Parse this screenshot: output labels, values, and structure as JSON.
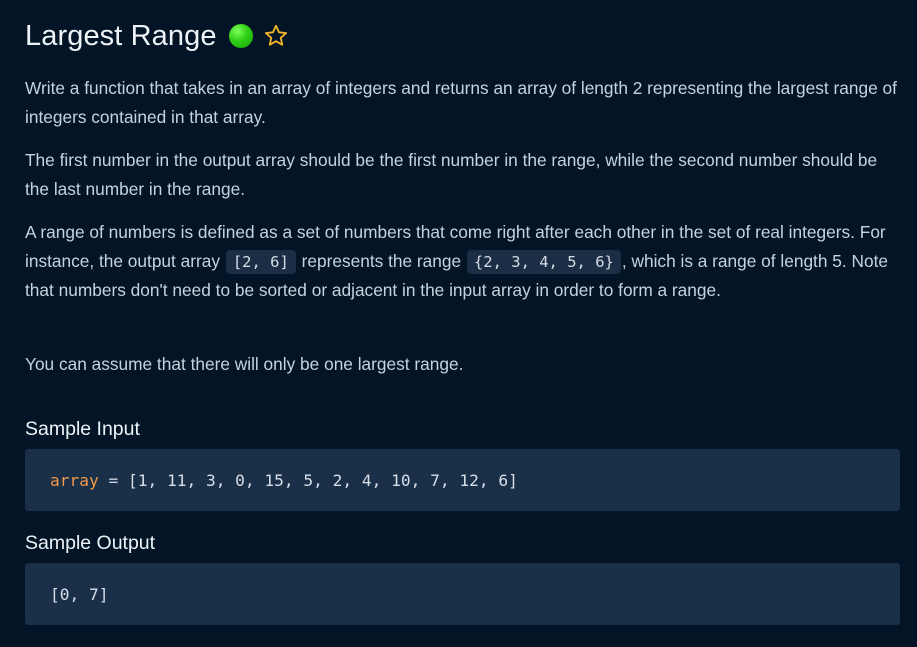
{
  "problem": {
    "title": "Largest Range",
    "difficulty_color": "#22c316",
    "difficulty_icon": "green-dot-icon",
    "favorite_icon": "star-outline-icon",
    "star_color": "#f0b429"
  },
  "description": {
    "p1": "Write a function that takes in an array of integers and returns an array of length 2 representing the largest range of integers contained in that array.",
    "p2": "The first number in the output array should be the first number in the range, while the second number should be the last number in the range.",
    "p3_part1": "A range of numbers is defined as a set of numbers that come right after each other in the set of real integers. For instance, the output array ",
    "p3_code1": "[2, 6]",
    "p3_part2": " represents the range ",
    "p3_code2": "{2, 3, 4, 5, 6}",
    "p3_part3": ", which is a range of length 5. Note that numbers don't need to be sorted or adjacent in the input array in order to form a range.",
    "p4": "You can assume that there will only be one largest range."
  },
  "sample_input": {
    "heading": "Sample Input",
    "var_name": "array",
    "operator": " = ",
    "value": "[1, 11, 3, 0, 15, 5, 2, 4, 10, 7, 12, 6]"
  },
  "sample_output": {
    "heading": "Sample Output",
    "value": "[0, 7]"
  }
}
